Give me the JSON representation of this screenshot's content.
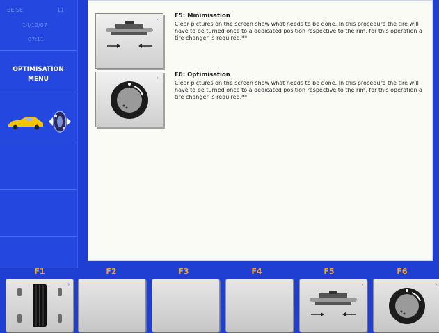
{
  "sidebar": {
    "header_line1": "BEISE",
    "header_line1b": "11",
    "header_line2": "14/12/07",
    "header_line3": "07:11",
    "title_line1": "OPTIMISATION",
    "title_line2": "MENU",
    "icons": [
      "car-icon",
      "wheel-balance-icon"
    ]
  },
  "content": {
    "items": [
      {
        "title": "F5: Minimisation",
        "description": "Clear pictures on the screen show what needs to be done. In this procedure the tire will have to be turned once to a dedicated position respective to the rim, for this operation a tire changer is required.**",
        "icon": "wheel-minimisation-icon"
      },
      {
        "title": "F6: Optimisation",
        "description": "Clear pictures on the screen show what needs to be done. In this procedure the tire will have to be turned once to a dedicated position respective to the rim, for this operation a tire changer is required.**",
        "icon": "wheel-optimisation-icon"
      }
    ]
  },
  "function_keys": [
    {
      "label": "F1",
      "icon": "tires-top-view-icon"
    },
    {
      "label": "F2",
      "icon": ""
    },
    {
      "label": "F3",
      "icon": ""
    },
    {
      "label": "F4",
      "icon": ""
    },
    {
      "label": "F5",
      "icon": "wheel-minimisation-icon"
    },
    {
      "label": "F6",
      "icon": "wheel-optimisation-icon"
    }
  ],
  "colors": {
    "background": "#1e3fd2",
    "function_key_label": "#f3a51c",
    "panel": "#fbfbf6"
  }
}
